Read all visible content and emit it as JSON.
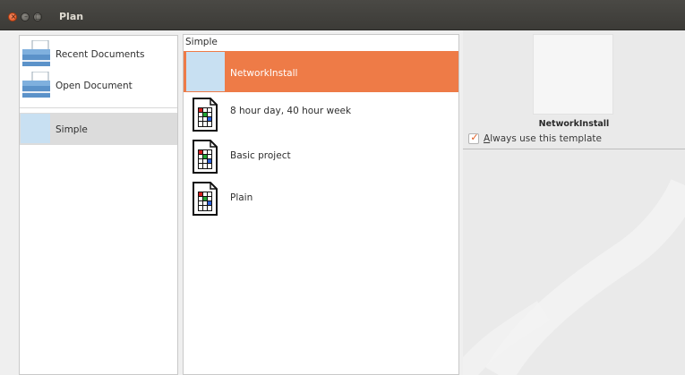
{
  "window": {
    "title": "Plan",
    "controls": {
      "close_icon": "close-icon",
      "minimize_icon": "minimize-icon",
      "maximize_icon": "maximize-icon"
    }
  },
  "sidebar": {
    "items": [
      {
        "label": "Recent Documents",
        "icon": "recent-documents-icon"
      },
      {
        "label": "Open Document",
        "icon": "open-document-icon"
      }
    ],
    "categories": [
      {
        "label": "Simple",
        "selected": true
      }
    ]
  },
  "templates": {
    "header": "Simple",
    "items": [
      {
        "label": "NetworkInstall",
        "selected": true
      },
      {
        "label": "8 hour day, 40 hour week",
        "selected": false
      },
      {
        "label": "Basic project",
        "selected": false
      },
      {
        "label": "Plain",
        "selected": false
      }
    ]
  },
  "preview": {
    "name": "NetworkInstall",
    "always_use_prefix": "A",
    "always_use_rest": "lways use this template",
    "always_use_checked": true
  },
  "colors": {
    "accent": "#ee7b47",
    "titlebar": "#3c3b37",
    "selection_thumb": "#c8e0f2"
  }
}
